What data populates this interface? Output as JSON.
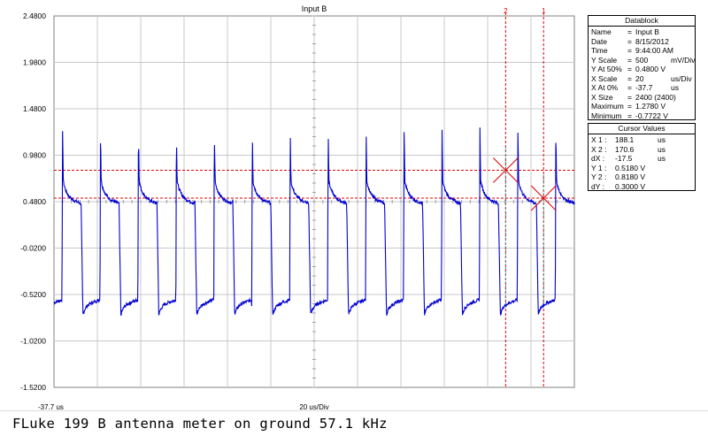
{
  "plot": {
    "title": "Input B",
    "y_ticks": [
      "2.4800",
      "1.9800",
      "1.4800",
      "0.9800",
      "0.4800",
      "-0.0200",
      "-0.5200",
      "-1.0200",
      "-1.5200"
    ],
    "x_start_label": "-37.7 us",
    "x_scale_label": "20 us/Div",
    "cursor_1_label": "1",
    "cursor_2_label": "2",
    "trace_color": "#0000d0",
    "cursor_color": "#e00000",
    "grid_color": "#c8c8c8"
  },
  "chart_data": {
    "type": "line",
    "title": "Input B",
    "xlabel": "20 us/Div",
    "ylabel": "",
    "ylim": [
      -1.52,
      2.48
    ],
    "xlim_us": [
      -37.7,
      202.3
    ],
    "grid": true,
    "series": [
      {
        "waveform": "square wave with spikes",
        "period_us": 17.5,
        "frequency_khz": 57.1,
        "high_level_v": 0.52,
        "low_level_v": -0.64,
        "spike_peak_v": 1.278,
        "minimum_v": -0.7722,
        "first_rising_edge_us": -34.0,
        "cycles_visible": 14
      }
    ],
    "cursors": [
      {
        "label": "1",
        "x_us": 188.1,
        "y_v": 0.518
      },
      {
        "label": "2",
        "x_us": 170.6,
        "y_v": 0.818
      }
    ]
  },
  "datablock": {
    "title": "Datablock",
    "rows": [
      {
        "label": "Name",
        "eq": "=",
        "value": "Input B",
        "unit": ""
      },
      {
        "label": "Date",
        "eq": "=",
        "value": "8/15/2012",
        "unit": ""
      },
      {
        "label": "Time",
        "eq": "=",
        "value": "9:44:00 AM",
        "unit": ""
      },
      {
        "label": "Y Scale",
        "eq": "=",
        "value": "500",
        "unit": "mV/Div"
      },
      {
        "label": "Y At 50%",
        "eq": "=",
        "value": "0.4800 V",
        "unit": ""
      },
      {
        "label": "X Scale",
        "eq": "=",
        "value": "20",
        "unit": "us/Div"
      },
      {
        "label": "X At 0%",
        "eq": "=",
        "value": "-37.7",
        "unit": "us"
      },
      {
        "label": "X Size",
        "eq": "=",
        "value": "2400 (2400)",
        "unit": ""
      },
      {
        "label": "Maximum",
        "eq": "=",
        "value": "1.2780 V",
        "unit": ""
      },
      {
        "label": "Minimum",
        "eq": "=",
        "value": "-0.7722 V",
        "unit": ""
      }
    ]
  },
  "cursor_values": {
    "title": "Cursor Values",
    "rows": [
      {
        "label": "X 1 :",
        "value": "188.1",
        "unit": "us"
      },
      {
        "label": "X 2 :",
        "value": "170.6",
        "unit": "us"
      },
      {
        "label": "dX :",
        "value": "-17.5",
        "unit": "us"
      },
      {
        "label": "Y 1 :",
        "value": "0.5180 V",
        "unit": ""
      },
      {
        "label": "Y 2 :",
        "value": "0.8180 V",
        "unit": ""
      },
      {
        "label": "dY :",
        "value": "0.3000 V",
        "unit": ""
      }
    ]
  },
  "caption": "FLuke 199 B antenna meter on ground 57.1 kHz"
}
